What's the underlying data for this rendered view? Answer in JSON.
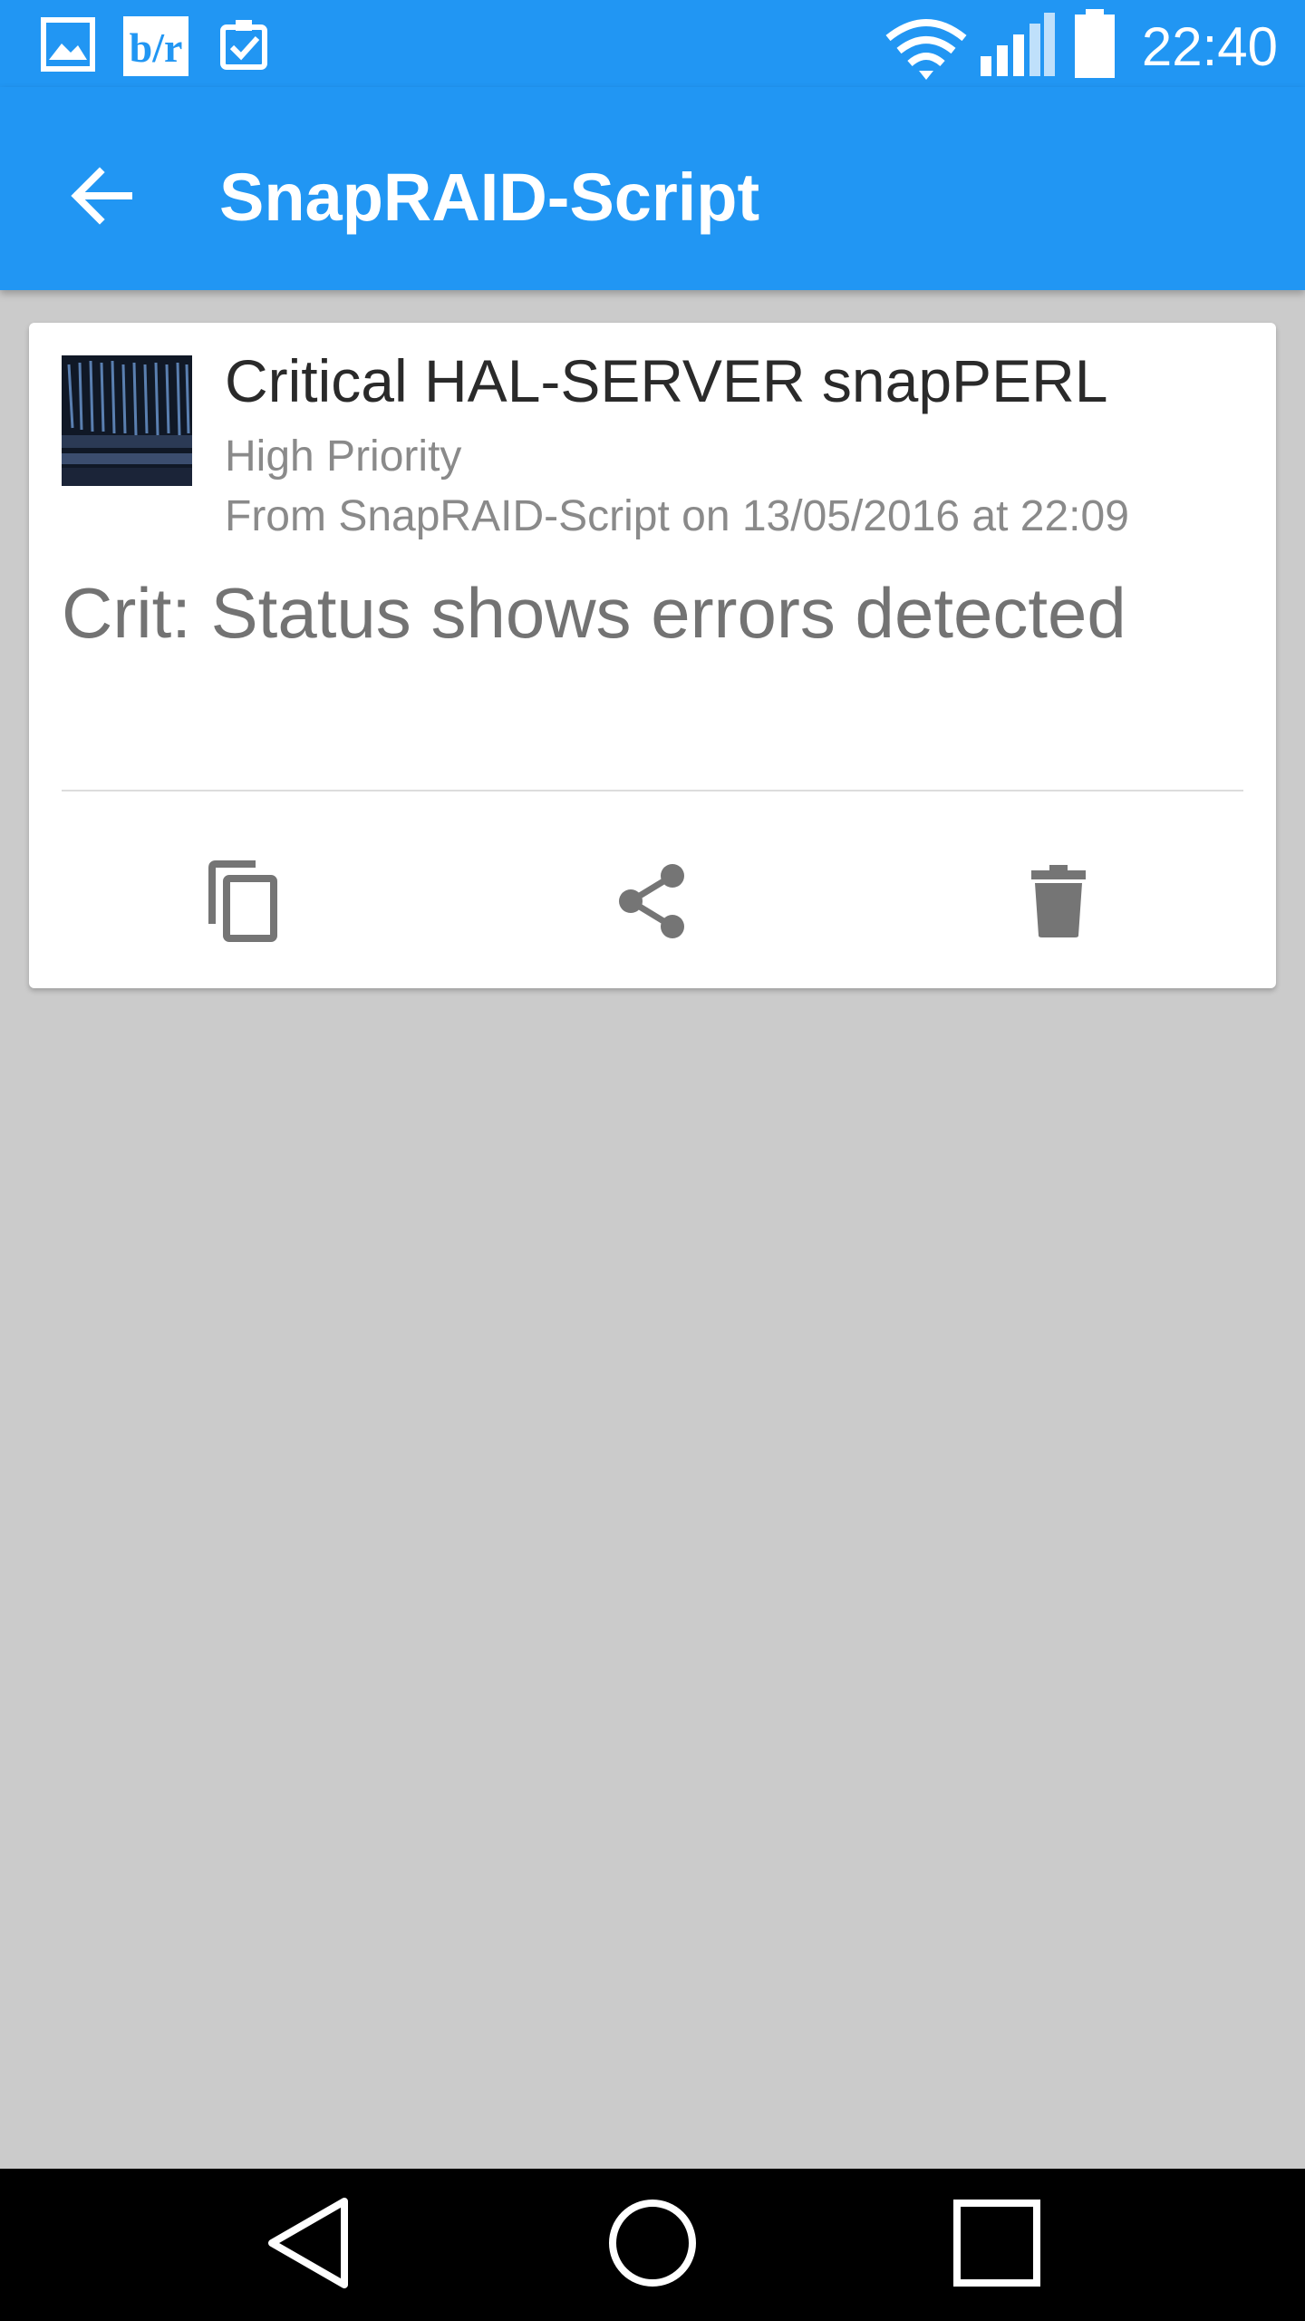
{
  "status_bar": {
    "time": "22:40",
    "notification_icons": [
      "gallery-icon",
      "bleacher-report-icon",
      "clipboard-check-icon"
    ],
    "system_icons": [
      "wifi-icon",
      "signal-icon",
      "battery-icon"
    ]
  },
  "app_bar": {
    "title": "SnapRAID-Script",
    "back_icon": "arrow-left-icon"
  },
  "message": {
    "title": "Critical HAL-SERVER snapPERL",
    "priority": "High Priority",
    "from_line": "From SnapRAID-Script on 13/05/2016 at 22:09",
    "body": "Crit: Status shows errors detected",
    "thumbnail": "server-rack-image"
  },
  "actions": {
    "icons": [
      "copy-icon",
      "share-icon",
      "delete-icon"
    ]
  },
  "nav_bar": {
    "icons": [
      "back-triangle-icon",
      "home-circle-icon",
      "recents-square-icon"
    ]
  },
  "colors": {
    "primary": "#2196f3",
    "background": "#cbcbcb",
    "card": "#ffffff",
    "action_icon": "#757575"
  }
}
